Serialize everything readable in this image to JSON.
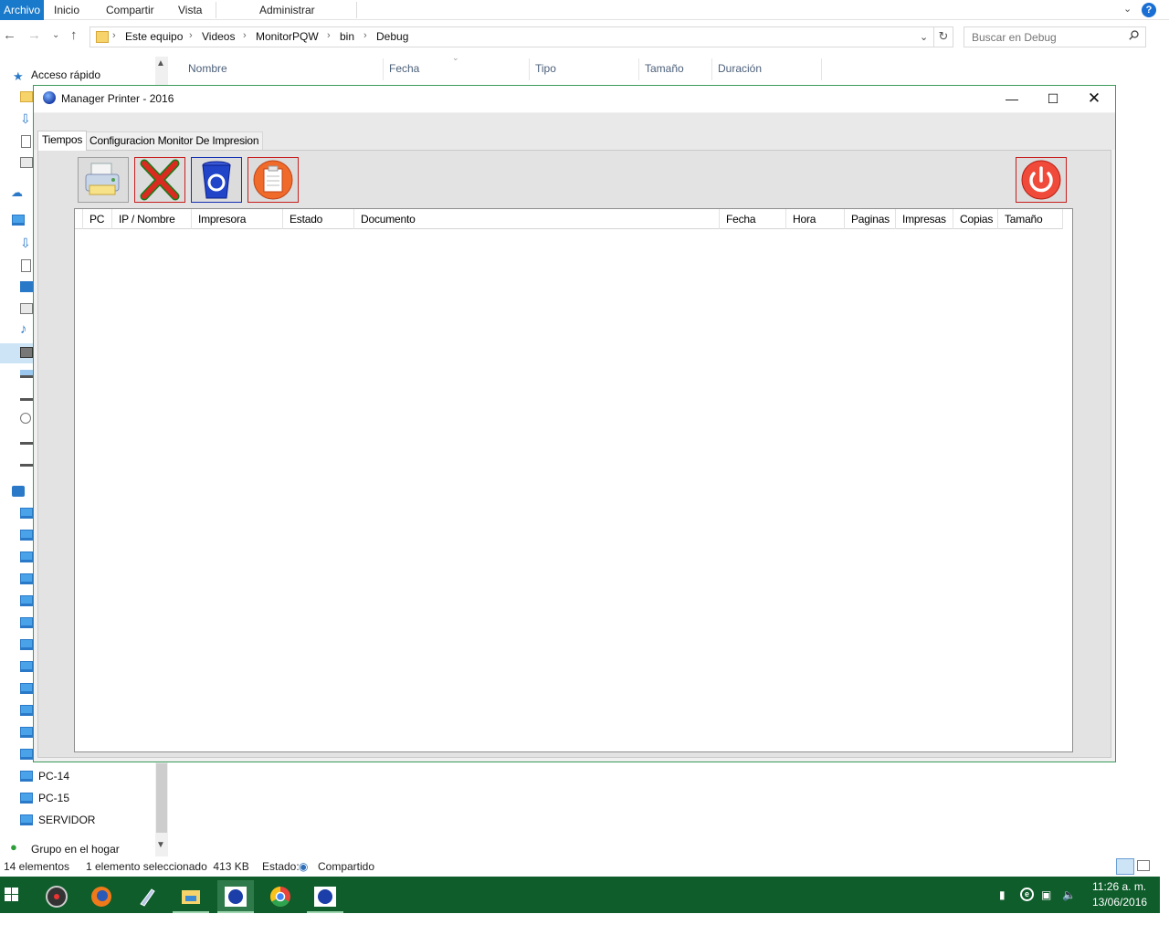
{
  "ribbon": {
    "tabs": [
      "Archivo",
      "Inicio",
      "Compartir",
      "Vista"
    ],
    "context_tab": "Administrar",
    "help_label": "?"
  },
  "address": {
    "crumbs": [
      "Este equipo",
      "Videos",
      "MonitorPQW",
      "bin",
      "Debug"
    ],
    "search_placeholder": "Buscar en Debug"
  },
  "explorer_columns": [
    "Nombre",
    "Fecha",
    "Tipo",
    "Tamaño",
    "Duración"
  ],
  "navpane": {
    "quick_access": "Acceso rápido",
    "pcs": [
      "PC-14",
      "PC-15",
      "SERVIDOR"
    ],
    "homegroup": "Grupo en el hogar"
  },
  "status": {
    "count": "14 elementos",
    "selection": "1 elemento seleccionado  413 KB",
    "state_label": "Estado:",
    "state_value": "Compartido"
  },
  "taskbar": {
    "time": "11:26 a. m.",
    "date": "13/06/2016"
  },
  "app": {
    "title": "Manager Printer - 2016",
    "tabs": [
      "Tiempos",
      "Configuracion Monitor De Impresion"
    ],
    "columns": [
      "PC",
      "IP / Nombre",
      "Impresora",
      "Estado",
      "Documento",
      "Fecha",
      "Hora",
      "Paginas",
      "Impresas",
      "Copias",
      "Tamaño"
    ],
    "toolbar_icons": [
      "printer-icon",
      "delete-x-icon",
      "recycle-bin-icon",
      "clipboard-icon",
      "power-icon"
    ]
  },
  "colors": {
    "accent": "#1979ca",
    "taskbar": "#0e5d2b",
    "danger": "#c81e1e"
  }
}
